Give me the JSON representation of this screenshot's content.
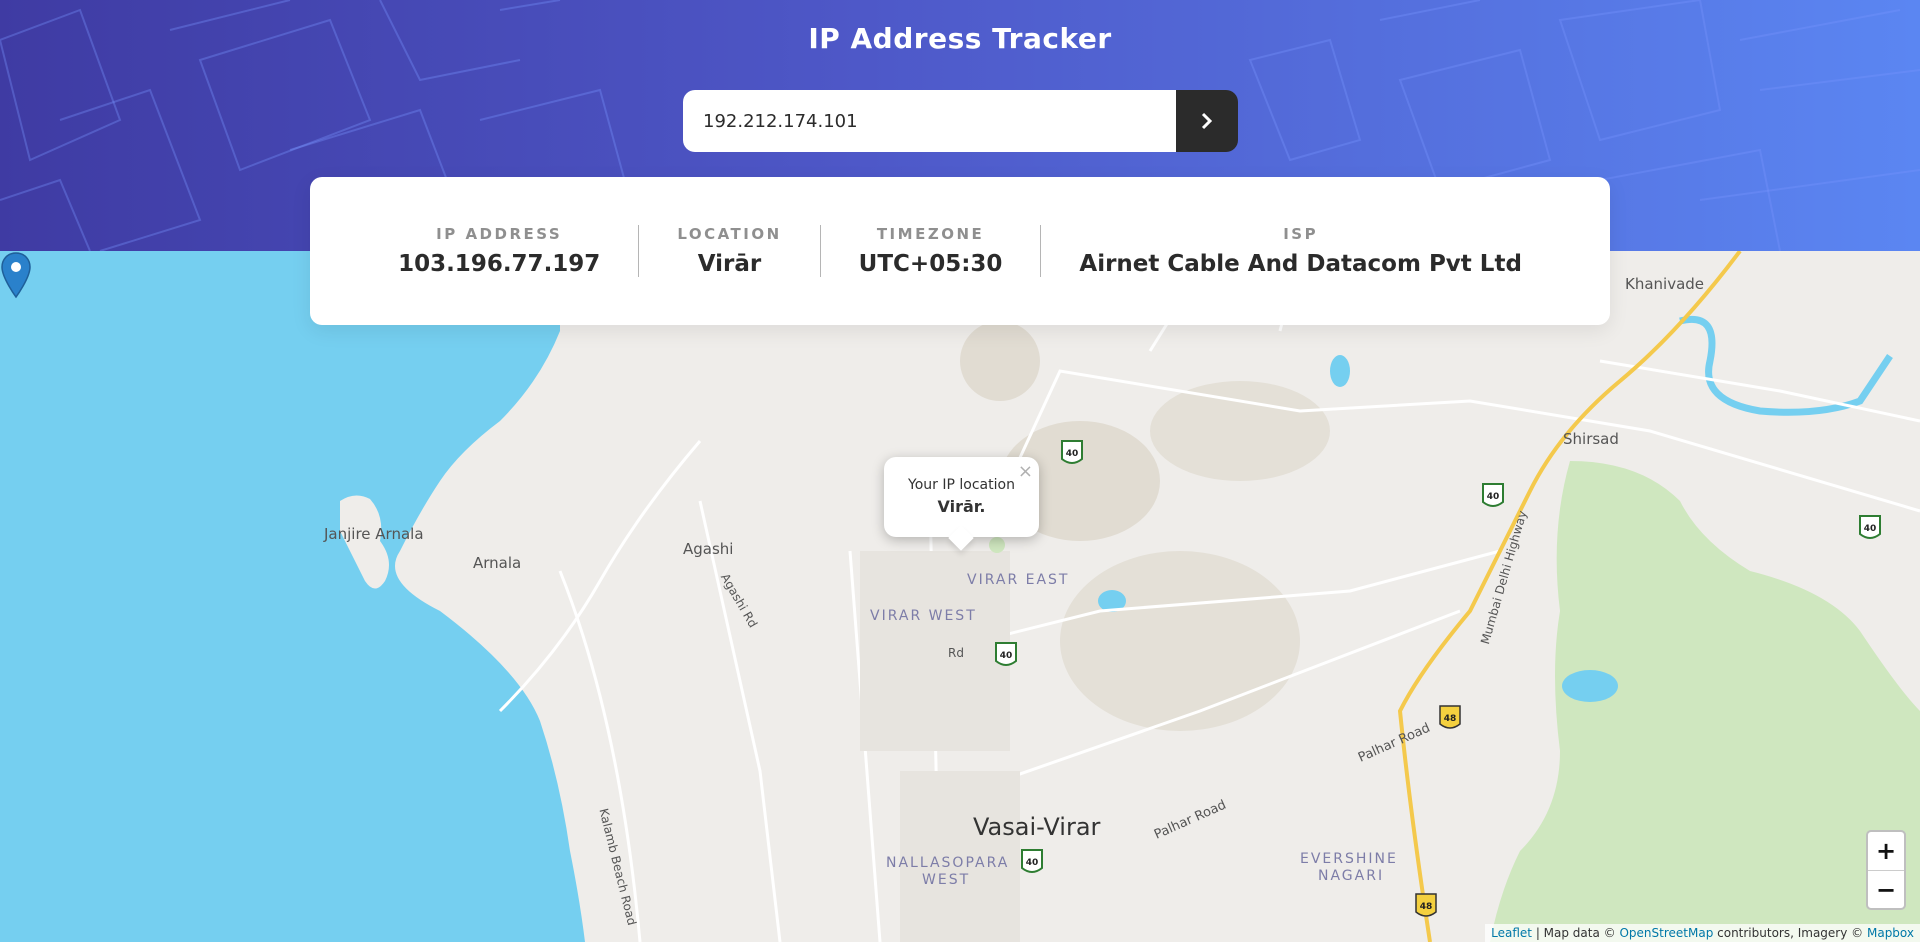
{
  "header": {
    "title": "IP Address Tracker",
    "search_value": "192.212.174.101",
    "search_button_icon": "chevron-right-icon"
  },
  "info": {
    "ip": {
      "label": "IP ADDRESS",
      "value": "103.196.77.197"
    },
    "location": {
      "label": "LOCATION",
      "value": "Virār"
    },
    "timezone": {
      "label": "TIMEZONE",
      "value": "UTC+05:30"
    },
    "isp": {
      "label": "ISP",
      "value": "Airnet Cable And Datacom Pvt Ltd"
    }
  },
  "map": {
    "popup": {
      "line1": "Your IP location",
      "line2": "Virār.",
      "close": "×"
    },
    "marker_icon": "map-pin-icon",
    "labels": {
      "khanivade": "Khanivade",
      "shirsad": "Shirsad",
      "janjire": "Janjire Arnala",
      "arnala": "Arnala",
      "agashi": "Agashi",
      "agashi_rd": "Agashi Rd",
      "virar_east": "VIRAR EAST",
      "virar_west": "VIRAR WEST",
      "rd": "Rd",
      "vasai_virar": "Vasai-Virar",
      "nallasopara": "NALLASOPARA",
      "nallasopara_west": "WEST",
      "evershine": "EVERSHINE",
      "nagari": "NAGARI",
      "palhar_road1": "Palhar Road",
      "palhar_road2": "Palhar Road",
      "kalamb": "Kalamb Beach Road",
      "mumbai_delhi": "Mumbai Delhi Highway"
    },
    "shields": [
      "40",
      "40",
      "40",
      "40",
      "40",
      "48",
      "48"
    ],
    "zoom_in": "+",
    "zoom_out": "−",
    "attribution": {
      "leaflet": "Leaflet",
      "sep": " | Map data © ",
      "osm": "OpenStreetMap",
      "mid": " contributors, Imagery © ",
      "mapbox": "Mapbox"
    }
  },
  "colors": {
    "header_start": "#3f3ba3",
    "header_end": "#5b86f2",
    "sea": "#75cff0",
    "land": "#efedea",
    "marker": "#2a81cb",
    "button": "#2b2b2b"
  }
}
